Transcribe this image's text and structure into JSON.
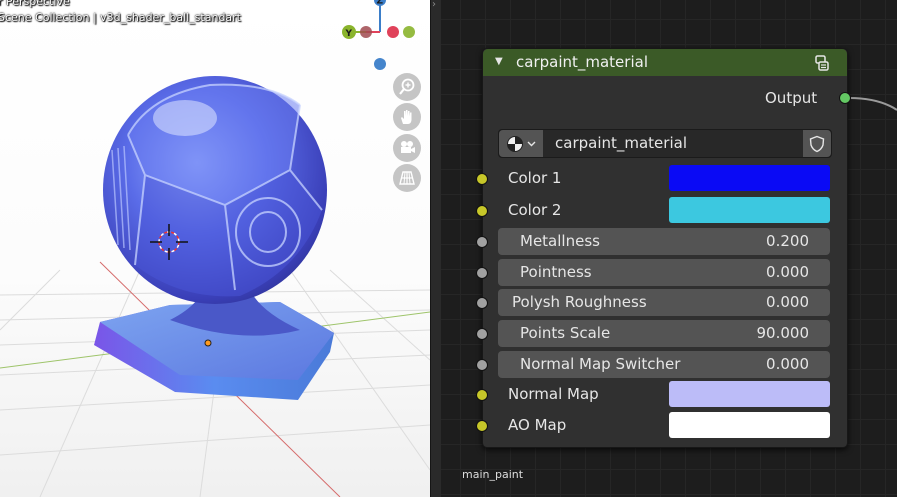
{
  "viewport": {
    "title": "r Perspective",
    "collection": "Scene Collection | v3d_shader_ball_standart",
    "gizmo": {
      "z_label": "Z",
      "y_label": "Y",
      "x_color": "#e0425a",
      "y_color": "#8ab42c",
      "z_color": "#3b7ec9"
    },
    "nav_buttons": [
      {
        "name": "zoom-icon"
      },
      {
        "name": "pan-hand-icon"
      },
      {
        "name": "camera-icon"
      },
      {
        "name": "perspective-grid-icon"
      }
    ],
    "divider_glyph": "›"
  },
  "node_editor": {
    "frame_label": "main_paint",
    "node": {
      "title": "carpaint_material",
      "header_color": "#3b5a27",
      "output_label": "Output",
      "datablock_name": "carpaint_material",
      "inputs": [
        {
          "label": "Color 1",
          "type": "color",
          "value": "#0a0af5"
        },
        {
          "label": "Color 2",
          "type": "color",
          "value": "#3cc8e0"
        },
        {
          "label": "Metallness",
          "type": "value",
          "value": "0.200"
        },
        {
          "label": "Pointness",
          "type": "value",
          "value": "0.000"
        },
        {
          "label": "Polysh Roughness",
          "type": "value",
          "value": "0.000"
        },
        {
          "label": "Points Scale",
          "type": "value",
          "value": "90.000"
        },
        {
          "label": "Normal Map Switcher",
          "type": "value",
          "value": "0.000"
        },
        {
          "label": "Normal Map",
          "type": "color",
          "value": "#bcbcf8"
        },
        {
          "label": "AO Map",
          "type": "color",
          "value": "#ffffff"
        }
      ]
    }
  }
}
